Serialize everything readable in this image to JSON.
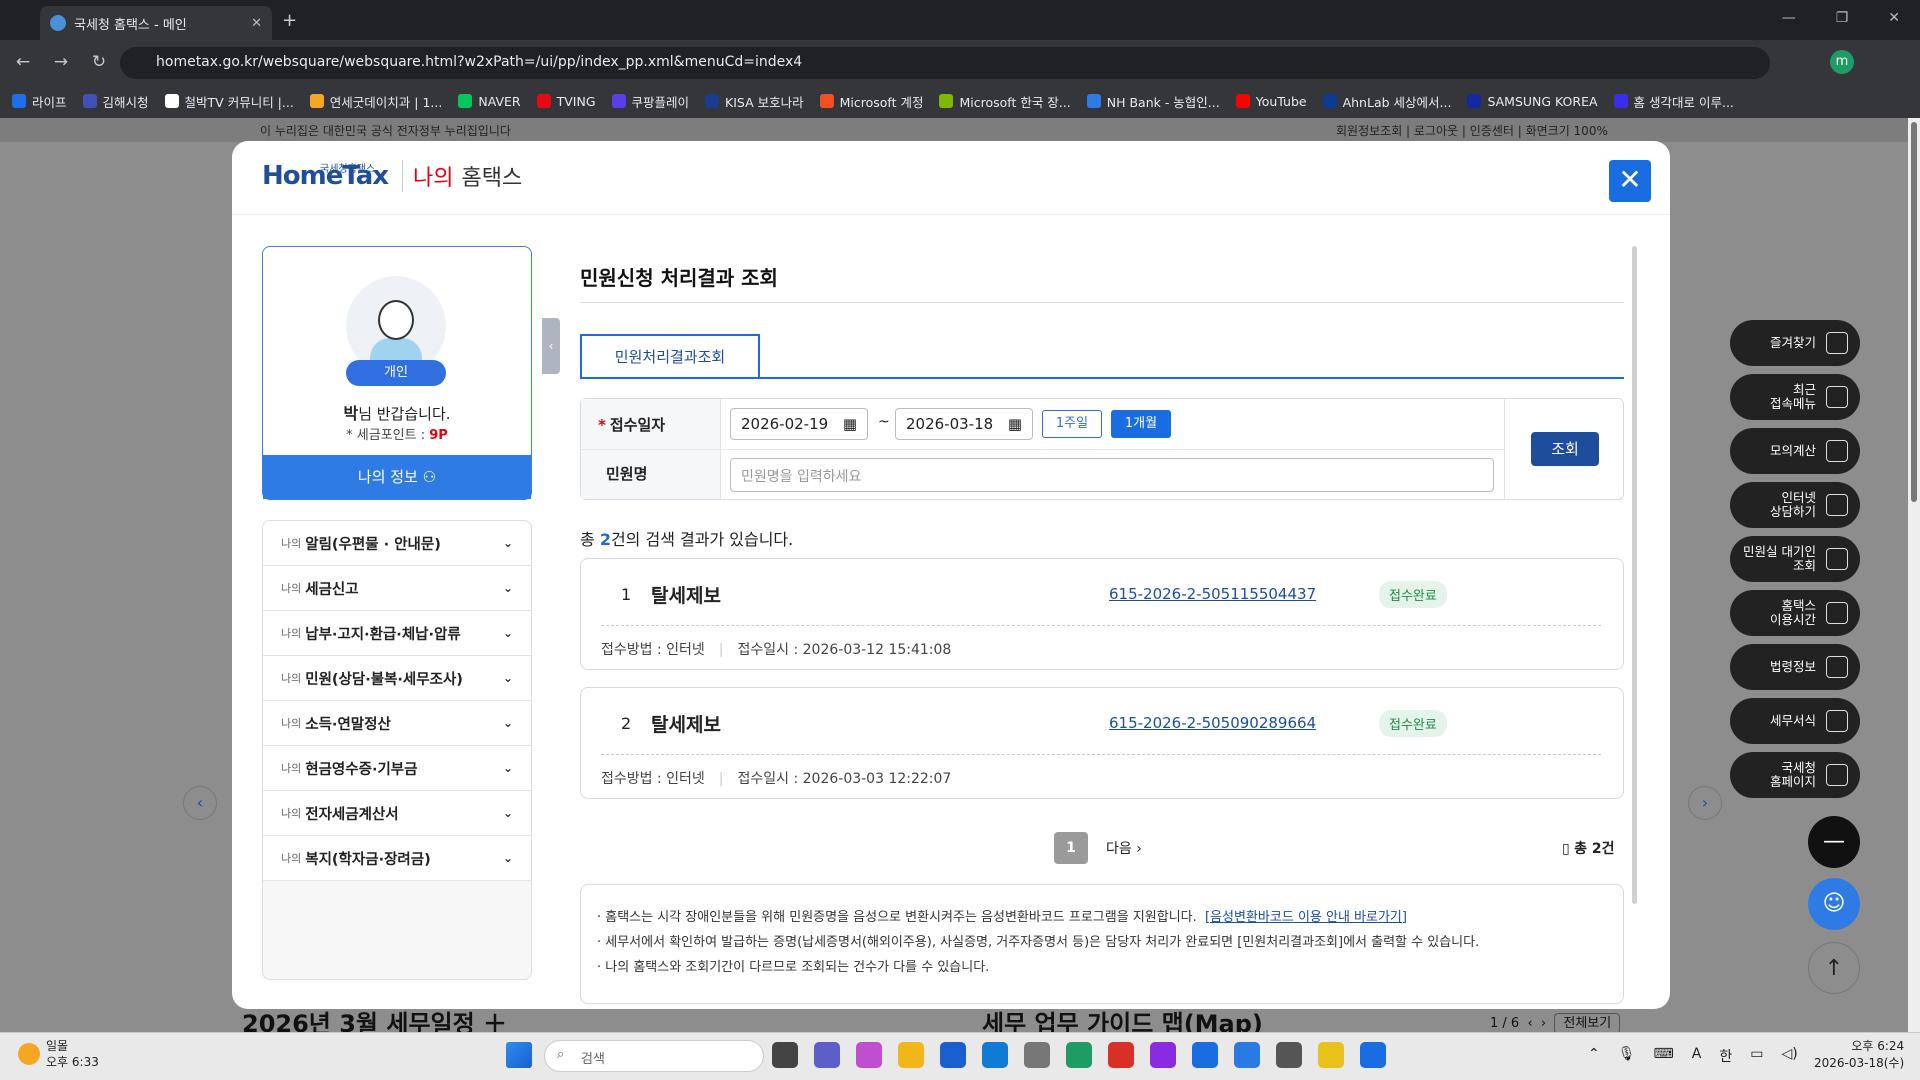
{
  "browser": {
    "tab_title": "국세청 홈택스 - 메인",
    "tab_close": "✕",
    "new_tab": "+",
    "url": "hometax.go.kr/websquare/websquare.html?w2xPath=/ui/pp/index_pp.xml&menuCd=index4",
    "profile_initial": "m",
    "bookmarks": [
      {
        "label": "라이프",
        "color": "#1f6feb"
      },
      {
        "label": "김해시청",
        "color": "#3f51b5"
      },
      {
        "label": "철박TV 커뮤니티 |...",
        "color": "#ffffff"
      },
      {
        "label": "연세굿데이치과 | 1...",
        "color": "#f5a623"
      },
      {
        "label": "NAVER",
        "color": "#03c75a"
      },
      {
        "label": "TVING",
        "color": "#e50914"
      },
      {
        "label": "쿠팡플레이",
        "color": "#5a3fe8"
      },
      {
        "label": "KISA 보호나라",
        "color": "#1a3d8f"
      },
      {
        "label": "Microsoft 계정",
        "color": "#f25022"
      },
      {
        "label": "Microsoft 한국 장...",
        "color": "#7fba00"
      },
      {
        "label": "NH Bank - 농협인...",
        "color": "#2f7be6"
      },
      {
        "label": "YouTube",
        "color": "#ff0000"
      },
      {
        "label": "AhnLab 세상에서...",
        "color": "#0a3d91"
      },
      {
        "label": "SAMSUNG KOREA",
        "color": "#1428a0"
      },
      {
        "label": "홈 생각대로 이루...",
        "color": "#3a2fe8"
      }
    ]
  },
  "page": {
    "gov_notice": "이 누리집은 대한민국 공식 전자정부 누리집입니다",
    "top_links": "회원정보조회 | 로그아웃 | 인증센터 | 화면크기 100%",
    "schedule_title": "2026년 3월 세무일정",
    "guide_title": "세무 업무 가이드 맵(Map)",
    "pager": "1 / 6",
    "view_all": "전체보기"
  },
  "modal": {
    "logo_small": "국세청홈택스",
    "logo_main": "HomeTax",
    "logo_my": "나의",
    "logo_hometax": "홈택스",
    "close": "✕",
    "profile": {
      "badge": "개인",
      "name": "박",
      "greeting": "님 반갑습니다.",
      "points_label": "* 세금포인트 :",
      "points_value": "9P",
      "my_info": "나의 정보"
    },
    "menu": [
      {
        "prefix": "나의",
        "label": "알림(우편물 · 안내문)"
      },
      {
        "prefix": "나의",
        "label": "세금신고"
      },
      {
        "prefix": "나의",
        "label": "납부·고지·환급·체납·압류"
      },
      {
        "prefix": "나의",
        "label": "민원(상담·불복·세무조사)"
      },
      {
        "prefix": "나의",
        "label": "소득·연말정산"
      },
      {
        "prefix": "나의",
        "label": "현금영수증·기부금"
      },
      {
        "prefix": "나의",
        "label": "전자세금계산서"
      },
      {
        "prefix": "나의",
        "label": "복지(학자금·장려금)"
      }
    ],
    "title": "민원신청 처리결과 조회",
    "tab": "민원처리결과조회",
    "form": {
      "date_label": "접수일자",
      "date_from": "2026-02-19",
      "date_to": "2026-03-18",
      "tilde": "~",
      "btn_week": "1주일",
      "btn_month": "1개월",
      "name_label": "민원명",
      "name_placeholder": "민원명을 입력하세요",
      "search": "조회"
    },
    "count_prefix": "총 ",
    "count": "2",
    "count_suffix": "건의 검색 결과가 있습니다.",
    "results": [
      {
        "no": "1",
        "name": "탈세제보",
        "receipt": "615-2026-2-505115504437",
        "status": "접수완료",
        "method": "접수방법 : 인터넷",
        "datetime": "접수일시 : 2026-03-12 15:41:08"
      },
      {
        "no": "2",
        "name": "탈세제보",
        "receipt": "615-2026-2-505090289664",
        "status": "접수완료",
        "method": "접수방법 : 인터넷",
        "datetime": "접수일시 : 2026-03-03 12:22:07"
      }
    ],
    "pagination": {
      "current": "1",
      "next": "다음",
      "total_label": "총 2건"
    },
    "notice": [
      "홈택스는 시각 장애인분들을 위해 민원증명을 음성으로 변환시켜주는 음성변환바코드 프로그램을 지원합니다.",
      "세무서에서 확인하여 발급하는 증명(납세증명서(해외이주용), 사실증명, 거주자증명서 등)은 담당자 처리가 완료되면 [민원처리결과조회]에서 출력할 수 있습니다.",
      "나의 홈택스와 조회기간이 다르므로 조회되는 건수가 다를 수 있습니다."
    ],
    "notice_link": "[음성변환바코드 이용 안내 바로가기]"
  },
  "floating": [
    {
      "label": "즐겨찾기",
      "icon": "star-icon"
    },
    {
      "label": "최근\n접속메뉴",
      "icon": "clock-icon"
    },
    {
      "label": "모의계산",
      "icon": "calculator-icon"
    },
    {
      "label": "인터넷\n상담하기",
      "icon": "chat-icon"
    },
    {
      "label": "민원실 대기인\n조회",
      "icon": "person-search-icon"
    },
    {
      "label": "홈택스\n이용시간",
      "icon": "time-icon"
    },
    {
      "label": "법령정보",
      "icon": "gavel-icon"
    },
    {
      "label": "세무서식",
      "icon": "form-icon"
    },
    {
      "label": "국세청\n홈페이지",
      "icon": "building-icon"
    }
  ],
  "taskbar": {
    "weather_title": "일몰",
    "weather_time": "오후 6:33",
    "search": "검색",
    "time": "오후 6:24",
    "date": "2026-03-18(수)",
    "lang": "한",
    "app_colors": [
      "#444444",
      "#5b5fc7",
      "#c04fd0",
      "#f2b51a",
      "#1a5fd0",
      "#0f7bd6",
      "#777777",
      "#1f9c63",
      "#d93025",
      "#8a2be2",
      "#1a6de0",
      "#2a7ae2",
      "#555555",
      "#e8c21a",
      "#1a6de0"
    ]
  }
}
